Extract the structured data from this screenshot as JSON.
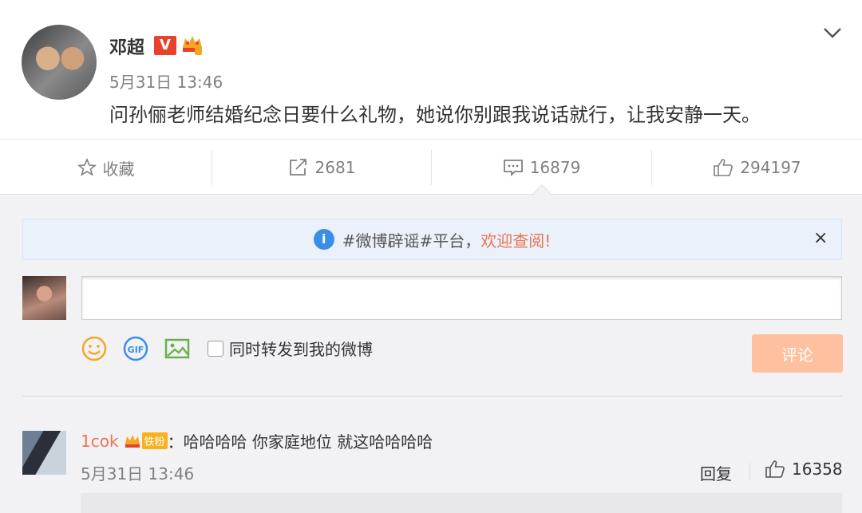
{
  "post": {
    "author": "邓超",
    "verified_badge": "V",
    "time": "5月31日 13:46",
    "text": "问孙俪老师结婚纪念日要什么礼物，她说你别跟我说话就行，让我安静一天。",
    "icons": [
      "avatar",
      "crown-icon",
      "chevron-down-icon"
    ]
  },
  "actions": {
    "favorite_label": "收藏",
    "repost_count": "2681",
    "comment_count": "16879",
    "like_count": "294197"
  },
  "notice": {
    "text": "#微博辟谣#平台，",
    "link": "欢迎查阅!",
    "close": "×",
    "info_glyph": "i"
  },
  "composer": {
    "placeholder": "",
    "repost_label": "同时转发到我的微博",
    "submit_label": "评论",
    "tools": [
      "emoji-icon",
      "gif-icon",
      "image-icon"
    ]
  },
  "comments": [
    {
      "user": "1cok",
      "fan_badge": "铁粉",
      "separator": "：",
      "text": "哈哈哈哈 你家庭地位 就这哈哈哈哈",
      "time": "5月31日 13:46",
      "reply_label": "回复",
      "likes": "16358"
    }
  ],
  "colors": {
    "accent": "#eb7350",
    "background": "#f2f2f5",
    "submit_disabled": "#ffc09f",
    "verified": "#e8412c"
  }
}
